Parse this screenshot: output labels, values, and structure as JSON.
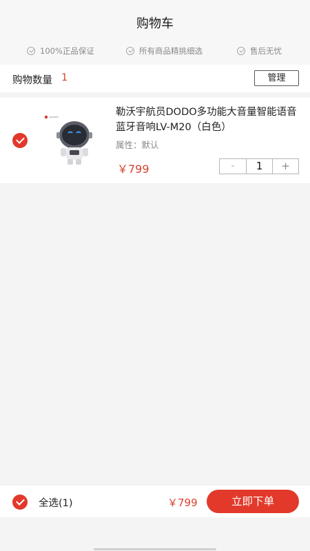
{
  "header": {
    "title": "购物车",
    "guarantees": [
      "100%正品保证",
      "所有商品精挑细选",
      "售后无忧"
    ]
  },
  "summary": {
    "count_label": "购物数量",
    "count": "1",
    "manage_label": "管理"
  },
  "cart": {
    "items": [
      {
        "selected": true,
        "name": "勒沃宇航员DODO多功能大音量智能语音蓝牙音响LV-M20（白色）",
        "attr_label": "属性：",
        "attr_value": "默认",
        "price": "￥799",
        "quantity": "1",
        "minus_label": "-",
        "plus_label": "+"
      }
    ]
  },
  "footer": {
    "select_all_label": "全选(1)",
    "total": "￥799",
    "checkout_label": "立即下单"
  },
  "colors": {
    "accent": "#e2392b",
    "price": "#d8412f",
    "background": "#f4f4f4"
  },
  "icons": {
    "guarantee": "check-circle-icon",
    "selected": "checked-radio-icon"
  }
}
